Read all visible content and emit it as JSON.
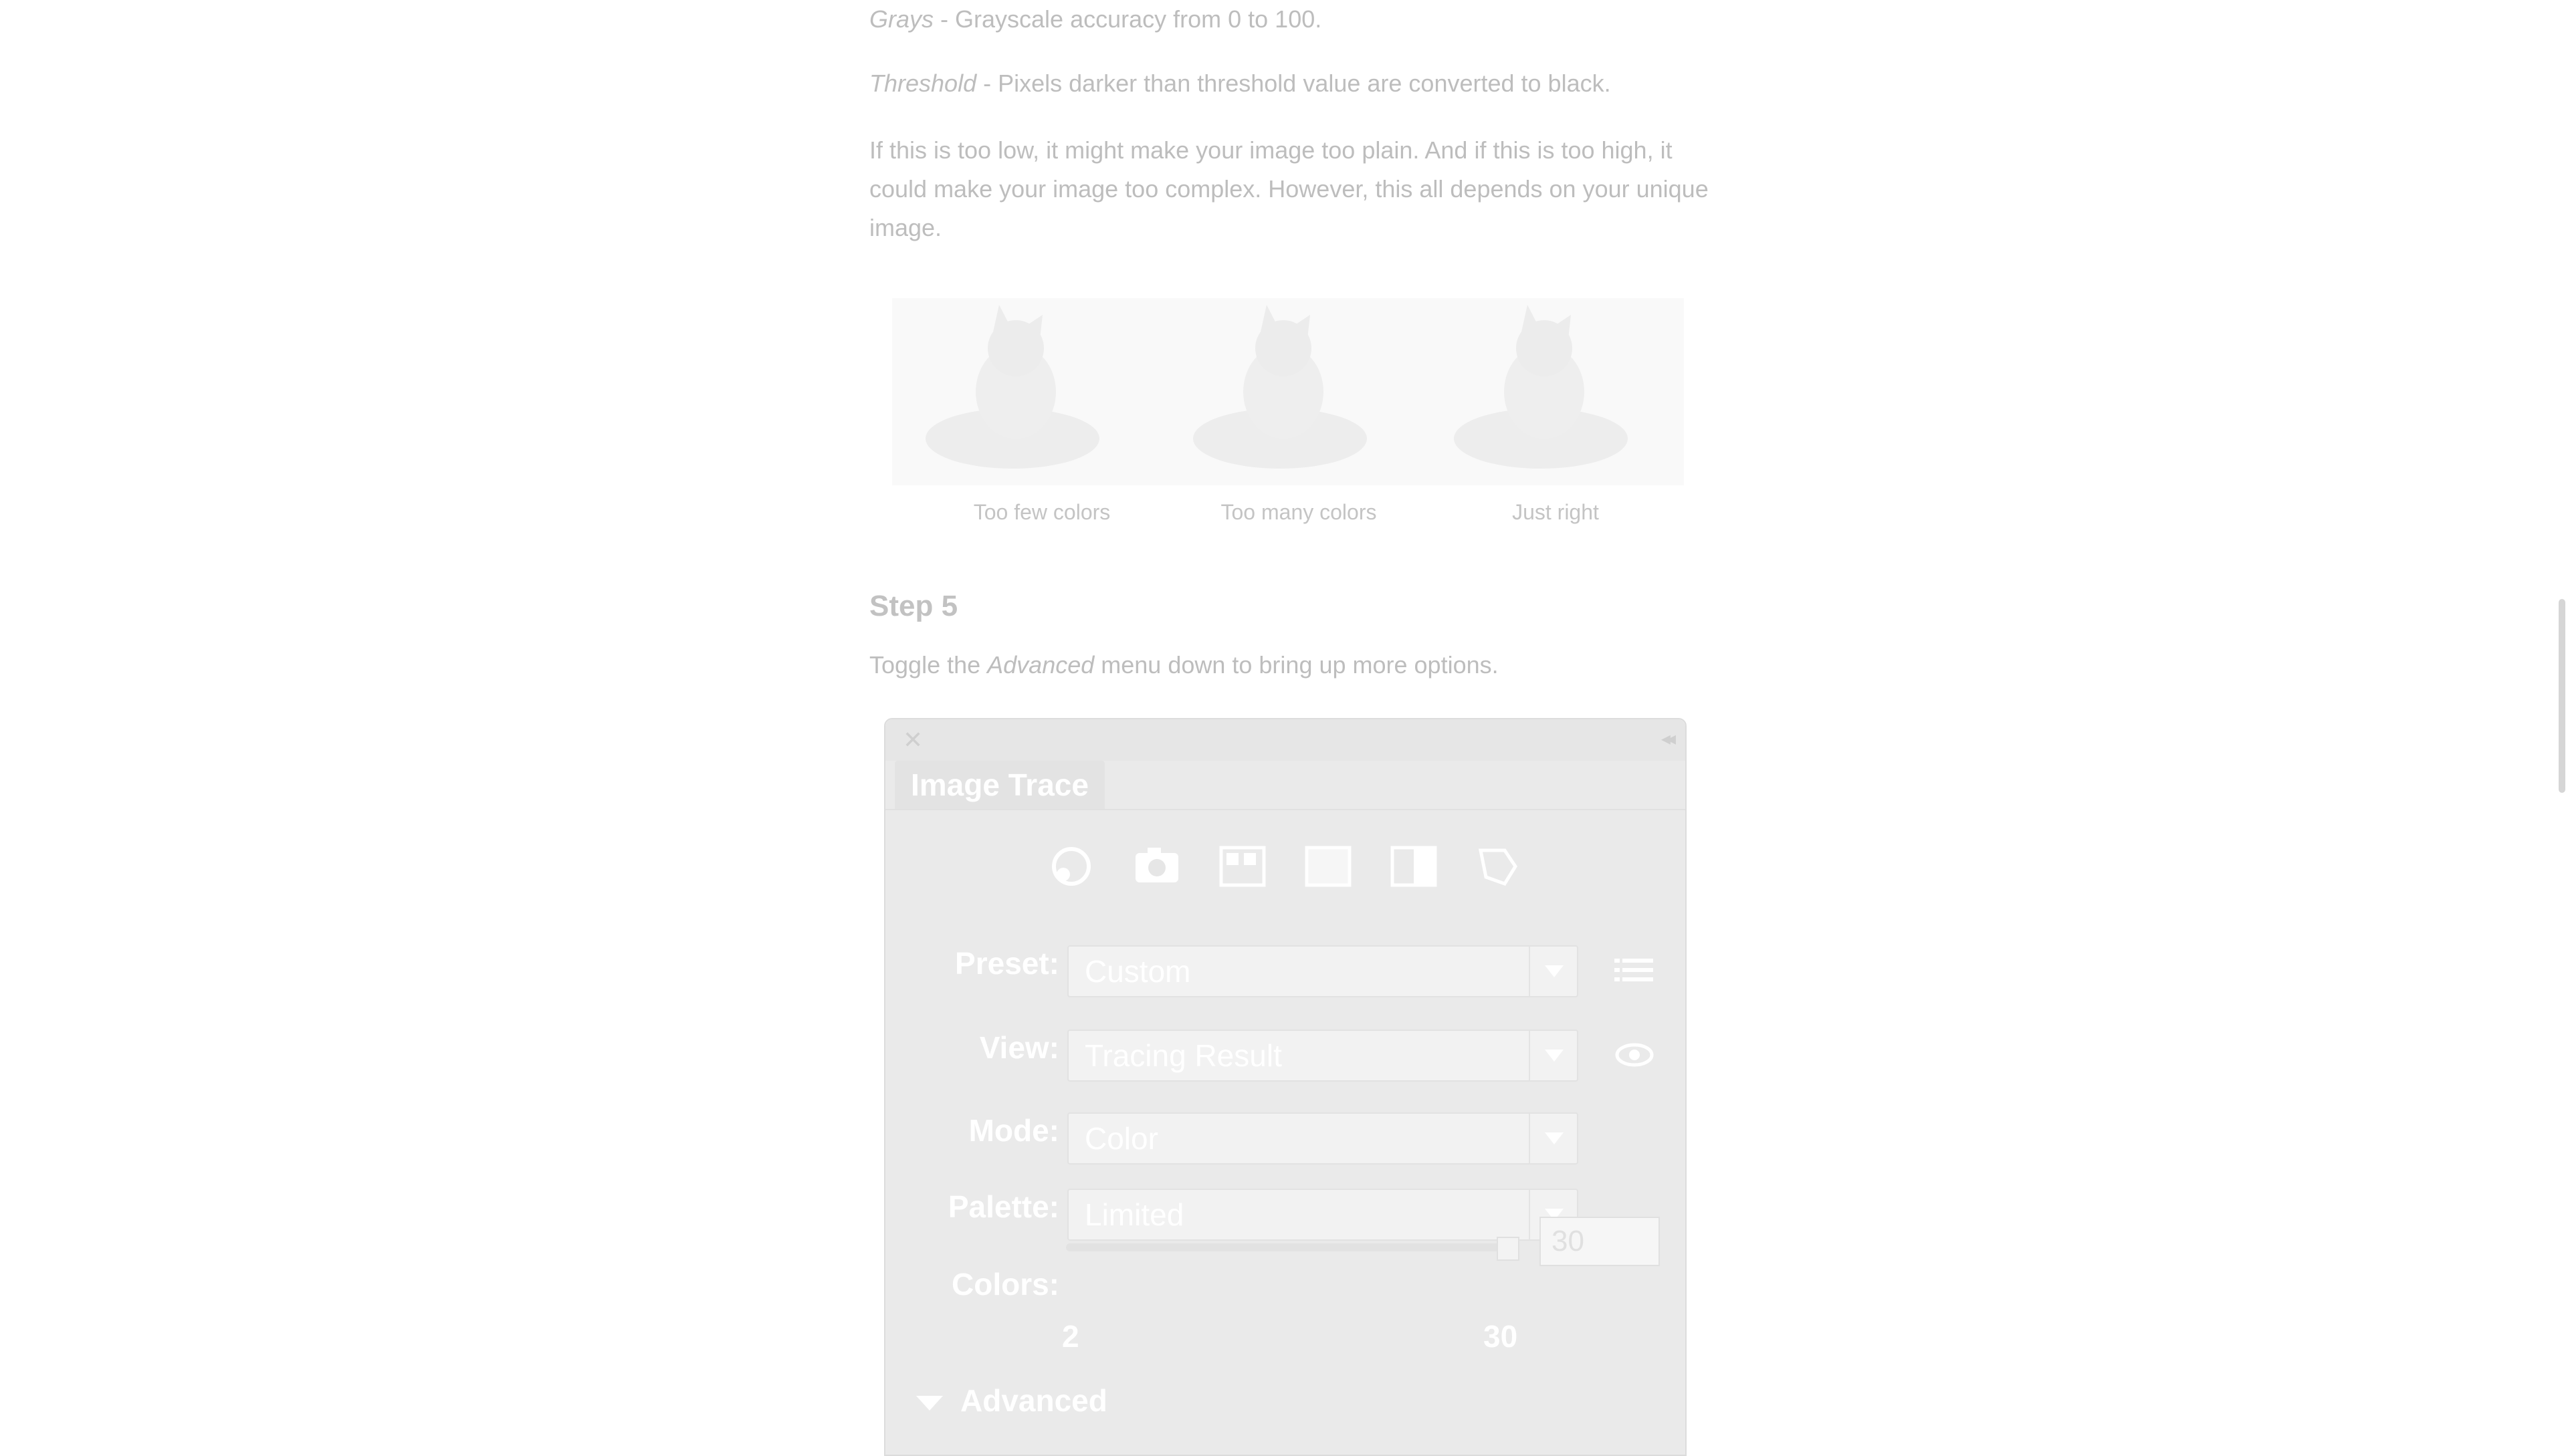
{
  "article": {
    "grays_term": "Grays",
    "grays_text": " - Grayscale accuracy from 0 to 100.",
    "threshold_term": "Threshold",
    "threshold_text": " - Pixels darker than threshold value are converted to black.",
    "note": "If this is too low, it might make your image too plain. And if this is too high, it could make your image too complex. However, this all depends on your unique image.",
    "captions": [
      "Too few colors",
      "Too many colors",
      "Just right"
    ],
    "step_title": "Step 5",
    "step_text_before": "Toggle the ",
    "step_text_term": "Advanced",
    "step_text_after": " menu down to bring up more options."
  },
  "panel": {
    "title": "Image Trace",
    "presets_icons": [
      "auto-color-icon",
      "photo-icon",
      "low-color-icon",
      "grayscale-icon",
      "black-white-icon",
      "outline-icon"
    ],
    "preset_label": "Preset:",
    "preset_value": "Custom",
    "view_label": "View:",
    "view_value": "Tracing Result",
    "mode_label": "Mode:",
    "mode_value": "Color",
    "palette_label": "Palette:",
    "palette_value": "Limited",
    "colors_label": "Colors:",
    "colors_value": "30",
    "colors_min": "2",
    "colors_max": "30",
    "colors_level": 1.0,
    "advanced_label": "Advanced"
  }
}
